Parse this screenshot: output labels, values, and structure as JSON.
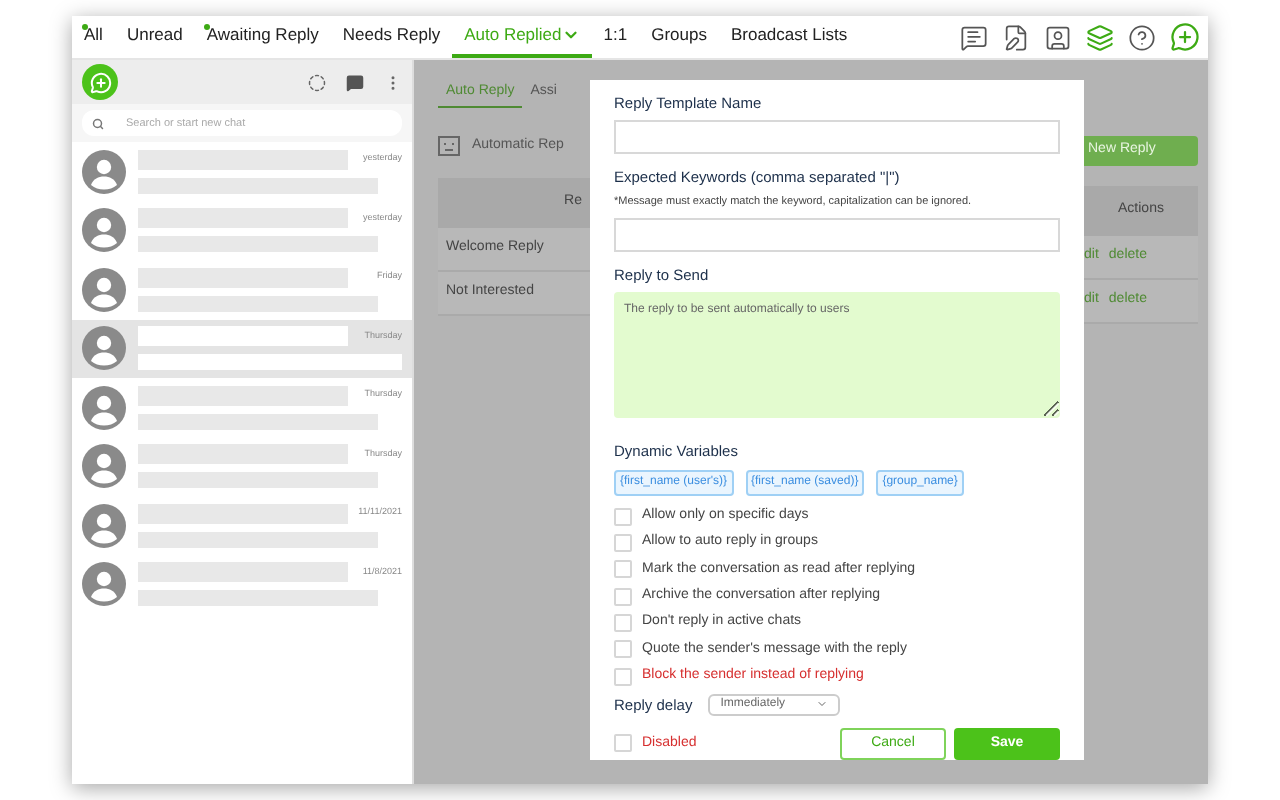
{
  "nav": {
    "tabs": [
      {
        "label": "All",
        "selected": false,
        "dot": true,
        "menu": false
      },
      {
        "label": "Unread",
        "selected": false,
        "dot": false,
        "menu": false
      },
      {
        "label": "Awaiting Reply",
        "selected": false,
        "dot": true,
        "menu": false
      },
      {
        "label": "Needs Reply",
        "selected": false,
        "dot": false,
        "menu": false
      },
      {
        "label": "Auto Replied",
        "selected": true,
        "dot": false,
        "menu": true
      },
      {
        "label": "1:1",
        "selected": false,
        "dot": false,
        "menu": false
      },
      {
        "label": "Groups",
        "selected": false,
        "dot": false,
        "menu": false
      },
      {
        "label": "Broadcast Lists",
        "selected": false,
        "dot": false,
        "menu": false
      }
    ]
  },
  "sidebar": {
    "search": {
      "placeholder": "Search or start new chat"
    },
    "chats": [
      {
        "time": "yesterday",
        "selected": false
      },
      {
        "time": "yesterday",
        "selected": false
      },
      {
        "time": "Friday",
        "selected": false
      },
      {
        "time": "Thursday",
        "selected": true
      },
      {
        "time": "Thursday",
        "selected": false
      },
      {
        "time": "Thursday",
        "selected": false
      },
      {
        "time": "11/11/2021",
        "selected": false
      },
      {
        "time": "11/8/2021",
        "selected": false
      }
    ]
  },
  "background": {
    "tabs": [
      {
        "label": "Auto Reply",
        "selected": true
      },
      {
        "label": "Assi",
        "selected": false
      }
    ],
    "heading": "Automatic Rep",
    "new_button": "New Reply",
    "table": {
      "columns": [
        "Re",
        "Actions"
      ],
      "rows": [
        {
          "name": "Welcome Reply",
          "edit": "dit",
          "delete": "delete"
        },
        {
          "name": "Not Interested",
          "edit": "dit",
          "delete": "delete"
        }
      ]
    }
  },
  "modal": {
    "name_label": "Reply Template Name",
    "keywords_label": "Expected Keywords (comma separated \"|\")",
    "keywords_note": "*Message must exactly match the keyword, capitalization can be ignored.",
    "reply_label": "Reply to Send",
    "reply_placeholder": "The reply to be sent automatically to users",
    "variables_label": "Dynamic Variables",
    "variables": [
      "{first_name (user's)}",
      "{first_name (saved)}",
      "{group_name}"
    ],
    "options": [
      {
        "label": "Allow only on specific days",
        "checked": false,
        "danger": false
      },
      {
        "label": "Allow to auto reply in groups",
        "checked": false,
        "danger": false
      },
      {
        "label": "Mark the conversation as read after replying",
        "checked": false,
        "danger": false
      },
      {
        "label": "Archive the conversation after replying",
        "checked": false,
        "danger": false
      },
      {
        "label": "Don't reply in active chats",
        "checked": false,
        "danger": false
      },
      {
        "label": "Quote the sender's message with the reply",
        "checked": false,
        "danger": false
      },
      {
        "label": "Block the sender instead of replying",
        "checked": false,
        "danger": true
      }
    ],
    "delay_label": "Reply delay",
    "delay_value": "Immediately",
    "disabled": {
      "label": "Disabled",
      "checked": false
    },
    "cancel": "Cancel",
    "save": "Save"
  }
}
